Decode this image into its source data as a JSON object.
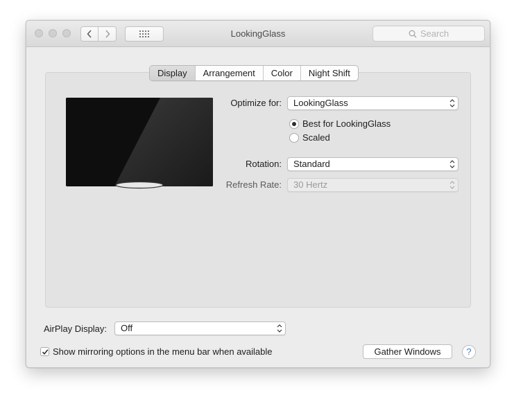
{
  "window": {
    "title": "LookingGlass",
    "search_placeholder": "Search"
  },
  "tabs": [
    {
      "label": "Display",
      "active": true
    },
    {
      "label": "Arrangement",
      "active": false
    },
    {
      "label": "Color",
      "active": false
    },
    {
      "label": "Night Shift",
      "active": false
    }
  ],
  "display": {
    "optimize_label": "Optimize for:",
    "optimize_value": "LookingGlass",
    "radio_best": "Best for LookingGlass",
    "radio_scaled": "Scaled",
    "selected_radio": "best",
    "rotation_label": "Rotation:",
    "rotation_value": "Standard",
    "refresh_label": "Refresh Rate:",
    "refresh_value": "30 Hertz"
  },
  "footer": {
    "airplay_label": "AirPlay Display:",
    "airplay_value": "Off",
    "mirror_checkbox_label": "Show mirroring options in the menu bar when available",
    "mirror_checked": true,
    "gather_button": "Gather Windows",
    "help_label": "?"
  },
  "colors": {
    "window_bg": "#ececec",
    "panel_bg": "#e3e3e3",
    "accent": "#3a7bd5"
  },
  "icons": {
    "back": "chevron-left-icon",
    "forward": "chevron-right-icon",
    "show_all": "grid-icon",
    "search": "search-icon",
    "popup": "up-down-arrows-icon",
    "checkbox": "checkmark-icon"
  }
}
